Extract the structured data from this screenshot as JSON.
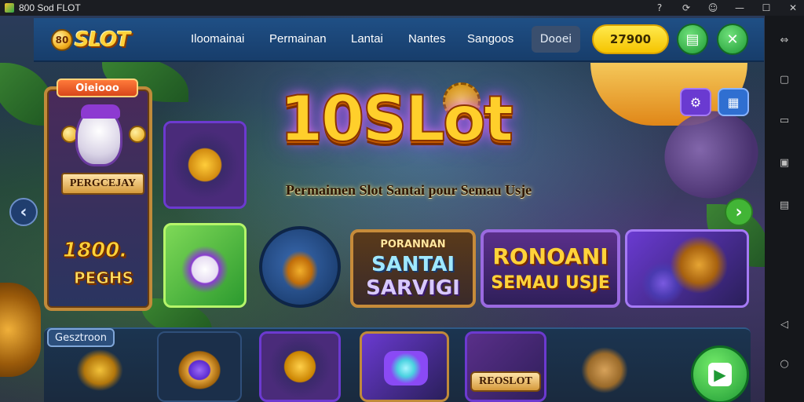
{
  "window": {
    "title": "800 Sod FLOT",
    "controls": [
      "help-icon",
      "refresh-icon",
      "settings-icon",
      "minimize-icon",
      "maximize-icon",
      "close-icon"
    ]
  },
  "sidepanel": {
    "buttons": [
      "expand-icon",
      "screenshot-icon",
      "window-icon",
      "fullscreen-icon",
      "keyboard-icon",
      "back-icon",
      "home-icon"
    ]
  },
  "nav": {
    "logo_coin": "80",
    "logo_text": "SLOT",
    "items": [
      "Iloomainai",
      "Permainan",
      "Lantai",
      "Nantes",
      "Sangoos"
    ],
    "login_label": "Dooei",
    "balance": "27900"
  },
  "hero": {
    "title": "10SLot",
    "subtitle": "Permaimen Slot Santai pour Semau Usje"
  },
  "featured": {
    "badge": "Oieiooo",
    "label": "PERGCEJAY",
    "amount": "1800.",
    "amount_label": "PEGHS"
  },
  "tiles": {
    "t4_line1": "PORANNAN",
    "t4_line2": "SANTAI",
    "t4_line3": "SARVIGI",
    "t5_line1": "RONOANI",
    "t5_line2": "SEMAU USJE"
  },
  "bottom": {
    "section_label": "Gesztroon",
    "tile5_label": "REOSLOT"
  },
  "colors": {
    "nav_bg": "#1f4f85",
    "accent_gold": "#ffcf2b",
    "accent_green": "#42b536",
    "balance_yellow": "#ffe94d"
  }
}
